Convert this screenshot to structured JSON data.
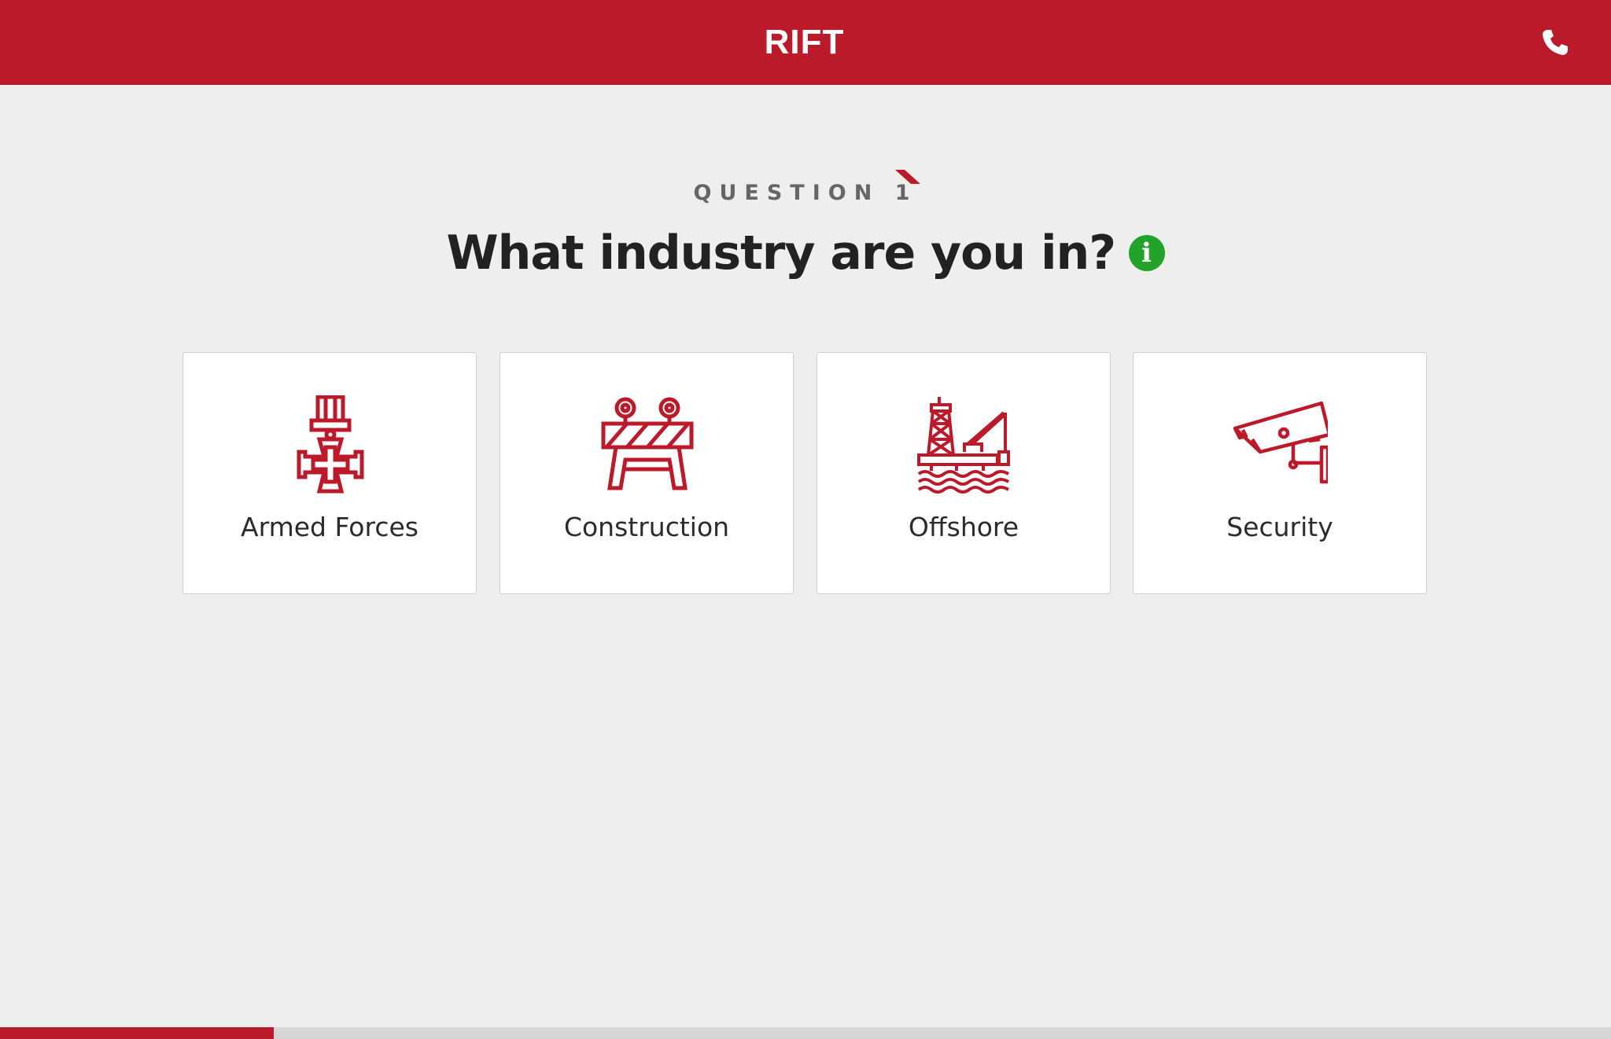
{
  "header": {
    "logo_text": "RIFT",
    "phone_icon": "phone-icon",
    "background_color": "#bb1a2a"
  },
  "question": {
    "label": "QUESTION 1",
    "title": "What industry are you in?",
    "info_icon": "info-icon",
    "info_glyph": "i"
  },
  "options": [
    {
      "label": "Armed Forces",
      "icon": "medal-cross-icon"
    },
    {
      "label": "Construction",
      "icon": "road-barrier-icon"
    },
    {
      "label": "Offshore",
      "icon": "oil-rig-icon"
    },
    {
      "label": "Security",
      "icon": "cctv-camera-icon"
    }
  ],
  "progress": {
    "fraction": 0.17
  },
  "colors": {
    "accent": "#bb1a2a",
    "info": "#23a32a",
    "background": "#eeeeee",
    "card": "#ffffff"
  }
}
